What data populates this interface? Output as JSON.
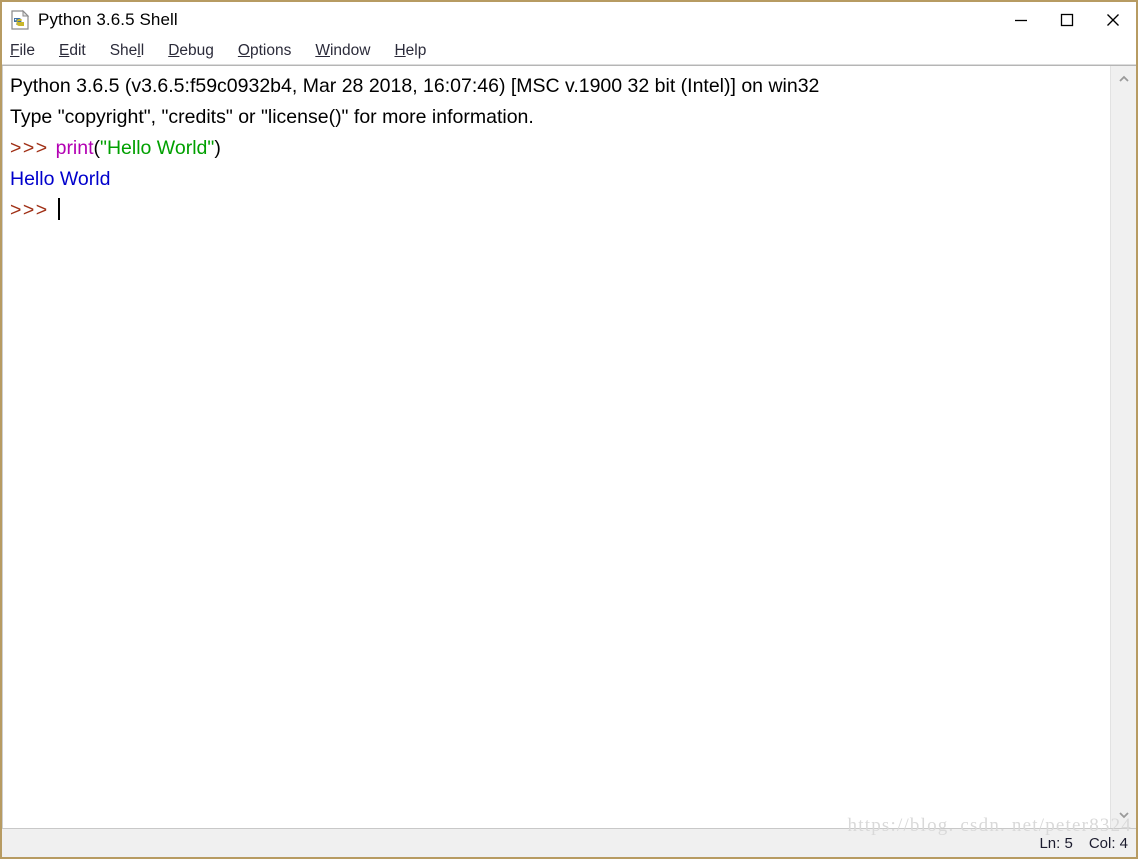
{
  "window": {
    "title": "Python 3.6.5 Shell",
    "icon": "python-idle-icon",
    "border_color": "#b79b62",
    "background": "#ffffff"
  },
  "titlebar": {
    "minimize_label": "minimize-icon",
    "maximize_label": "maximize-icon",
    "close_label": "close-icon"
  },
  "menubar": {
    "items": [
      {
        "label": "File",
        "pre": "",
        "mnemonic": "F",
        "post": "ile"
      },
      {
        "label": "Edit",
        "pre": "",
        "mnemonic": "E",
        "post": "dit"
      },
      {
        "label": "Shell",
        "pre": "She",
        "mnemonic": "l",
        "post": "l"
      },
      {
        "label": "Debug",
        "pre": "",
        "mnemonic": "D",
        "post": "ebug"
      },
      {
        "label": "Options",
        "pre": "",
        "mnemonic": "O",
        "post": "ptions"
      },
      {
        "label": "Window",
        "pre": "",
        "mnemonic": "W",
        "post": "indow"
      },
      {
        "label": "Help",
        "pre": "",
        "mnemonic": "H",
        "post": "elp"
      }
    ]
  },
  "shell": {
    "banner_line_1": "Python 3.6.5 (v3.6.5:f59c0932b4, Mar 28 2018, 16:07:46) [MSC v.1900 32 bit (Intel)] on win32",
    "banner_line_2": "Type \"copyright\", \"credits\" or \"license()\" for more information.",
    "prompt": ">>> ",
    "command_builtin": "print",
    "command_open_paren": "(",
    "command_string": "\"Hello World\"",
    "command_close_paren": ")",
    "output": "Hello World",
    "final_prompt": ">>> ",
    "colors": {
      "prompt": "#a03016",
      "builtin": "#b300b3",
      "string": "#00a000",
      "output": "#0000cc",
      "normal": "#000000"
    }
  },
  "scrollbar": {
    "up_arrow": "chevron-up-icon",
    "down_arrow": "chevron-down-icon"
  },
  "statusbar": {
    "line": "Ln: 5",
    "column": "Col: 4"
  },
  "watermark": {
    "text": "https://blog. csdn. net/peter8324"
  }
}
